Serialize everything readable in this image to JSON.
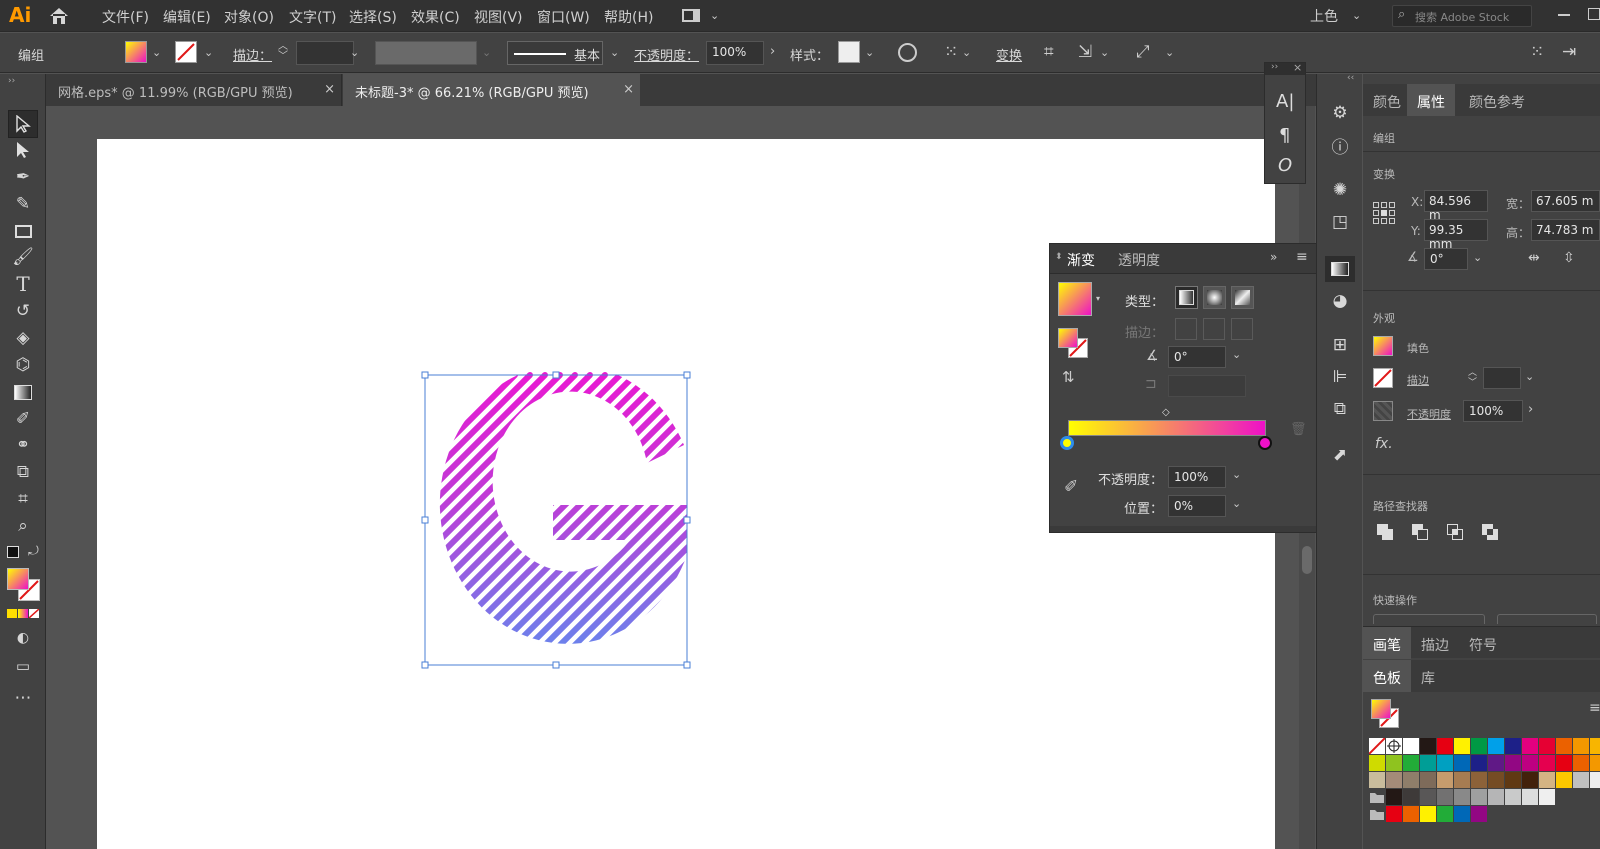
{
  "app": {
    "logo": "Ai",
    "workspace": "上色",
    "search_placeholder": "搜索 Adobe Stock"
  },
  "menu": [
    "文件(F)",
    "编辑(E)",
    "对象(O)",
    "文字(T)",
    "选择(S)",
    "效果(C)",
    "视图(V)",
    "窗口(W)",
    "帮助(H)"
  ],
  "control": {
    "selection_label": "编组",
    "stroke_label": "描边：",
    "stroke_style": "基本",
    "opacity_label": "不透明度：",
    "opacity_value": "100%",
    "style_label": "样式：",
    "transform_label": "变换"
  },
  "tabs": [
    {
      "label": "网格.eps* @ 11.99% (RGB/GPU 预览)",
      "close": "×"
    },
    {
      "label": "未标题-3* @ 66.21% (RGB/GPU 预览)",
      "close": "×"
    }
  ],
  "float_panel": {
    "chars": [
      "A|",
      "¶",
      "O"
    ]
  },
  "gradient_panel": {
    "tabs": [
      "渐变",
      "透明度"
    ],
    "type_label": "类型：",
    "stroke_label": "描边：",
    "angle": "0°",
    "opacity_label": "不透明度：",
    "opacity_value": "100%",
    "position_label": "位置：",
    "position_value": "0%",
    "stop_colors": [
      "#ffff00",
      "#ee10c8"
    ]
  },
  "properties": {
    "tabs": [
      "颜色",
      "属性",
      "颜色参考"
    ],
    "group_label": "编组",
    "transform_label": "变换",
    "x_label": "X:",
    "x_value": "84.596 m",
    "y_label": "Y:",
    "y_value": "99.35 mm",
    "w_label": "宽：",
    "w_value": "67.605 m",
    "h_label": "高：",
    "h_value": "74.783 m",
    "angle_value": "0°",
    "appearance_label": "外观",
    "fill_label": "填色",
    "stroke_label": "描边",
    "opacity_label": "不透明度",
    "opacity_value": "100%",
    "fx_label": "fx.",
    "pathfinder_label": "路径查找器",
    "quick_actions_label": "快速操作"
  },
  "bottom_panel": {
    "tabs": [
      "画笔",
      "描边",
      "符号"
    ],
    "subtabs": [
      "色板",
      "库"
    ]
  },
  "colors": {
    "gradient_start": "#ffff00",
    "gradient_end": "#ee10c8",
    "accent_blue": "#2d8ceb"
  }
}
